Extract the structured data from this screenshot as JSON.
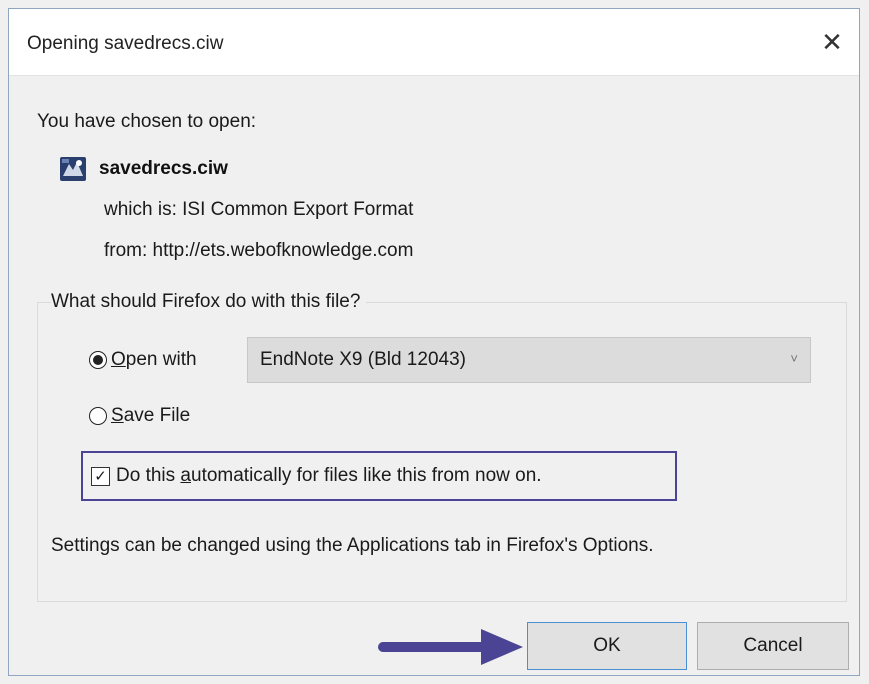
{
  "window": {
    "title": "Opening savedrecs.ciw",
    "close_glyph": "✕"
  },
  "intro": {
    "chosen_label": "You have chosen to open:"
  },
  "file": {
    "name": "savedrecs.ciw",
    "icon": "endnote-file-icon",
    "which_is": "which is:  ISI Common Export Format",
    "from": "from:  http://ets.webofknowledge.com"
  },
  "action_group": {
    "label": "What should Firefox do with this file?",
    "open_with": {
      "label_access": "O",
      "label_rest": "pen with",
      "selected": true
    },
    "app_select": {
      "value": "EndNote X9 (Bld 12043)",
      "chevron": "˅"
    },
    "save_file": {
      "label_access": "S",
      "label_rest": "ave File",
      "selected": false
    },
    "auto": {
      "checked": true,
      "check_glyph": "✓",
      "label_pre": "Do this ",
      "label_access": "a",
      "label_post": "utomatically for files like this from now on."
    },
    "settings_note": "Settings can be changed using the Applications tab in Firefox's Options."
  },
  "buttons": {
    "ok": "OK",
    "cancel": "Cancel"
  },
  "colors": {
    "highlight_border": "#4b4394",
    "arrow": "#4b4394"
  }
}
